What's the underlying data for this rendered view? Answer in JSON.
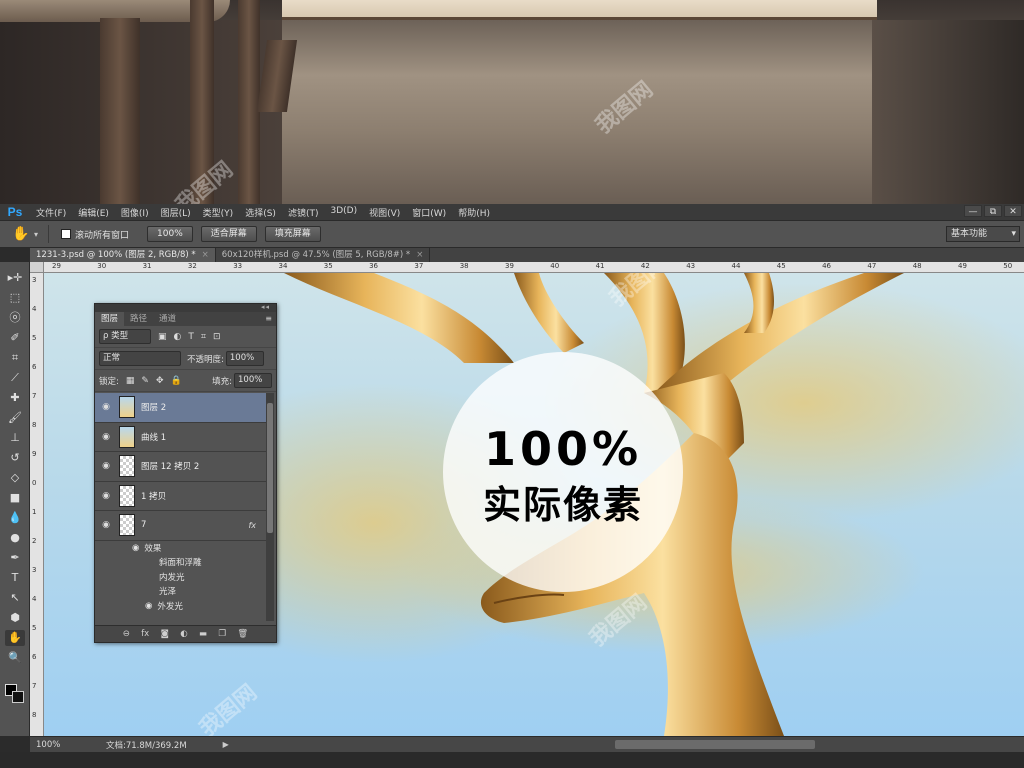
{
  "app": {
    "logo": "Ps"
  },
  "menu": [
    "文件(F)",
    "编辑(E)",
    "图像(I)",
    "图层(L)",
    "类型(Y)",
    "选择(S)",
    "滤镜(T)",
    "3D(D)",
    "视图(V)",
    "窗口(W)",
    "帮助(H)"
  ],
  "window_buttons": [
    "—",
    "⧉",
    "✕"
  ],
  "options_bar": {
    "scroll_all_windows": "滚动所有窗口",
    "scroll_all_windows_checked": false,
    "zoom_button": "100%",
    "fit_screen_button": "适合屏幕",
    "fill_screen_button": "填充屏幕",
    "workspace": "基本功能"
  },
  "documents": [
    {
      "title": "1231-3.psd @ 100% (图层 2, RGB/8) *",
      "active": true
    },
    {
      "title": "60x120样机.psd @ 47.5% (图层 5, RGB/8#) *",
      "active": false
    }
  ],
  "ruler": {
    "h": [
      "29",
      "30",
      "31",
      "32",
      "33",
      "34",
      "35",
      "36",
      "37",
      "38",
      "39",
      "40",
      "41",
      "42",
      "43",
      "44",
      "45",
      "46",
      "47",
      "48",
      "49",
      "50"
    ],
    "v": [
      "3",
      "4",
      "5",
      "6",
      "7",
      "8",
      "9",
      "0",
      "1",
      "2",
      "3",
      "4",
      "5",
      "6",
      "7",
      "8"
    ]
  },
  "overlay": {
    "big_text": "100%",
    "sub_text": "实际像素"
  },
  "watermark": "我图网",
  "status": {
    "zoom": "100%",
    "doc_info": "文档:71.8M/369.2M",
    "arrow": "▶"
  },
  "layers_panel": {
    "tabs": [
      "图层",
      "路径",
      "通道"
    ],
    "filter_kind": "ρ 类型",
    "blend_mode": "正常",
    "opacity_label": "不透明度:",
    "opacity_value": "100%",
    "lock_label": "锁定:",
    "fill_label": "填充:",
    "fill_value": "100%",
    "layers": [
      {
        "name": "图层 2",
        "selected": true,
        "thumb": "photo",
        "fx": ""
      },
      {
        "name": "曲线 1",
        "selected": false,
        "thumb": "photo",
        "fx": ""
      },
      {
        "name": "图层 12 拷贝 2",
        "selected": false,
        "thumb": "transparent",
        "fx": ""
      },
      {
        "name": "1 拷贝",
        "selected": false,
        "thumb": "transparent",
        "fx": ""
      },
      {
        "name": "7",
        "selected": false,
        "thumb": "transparent",
        "fx": "fx"
      }
    ],
    "effects_header": "效果",
    "effects": [
      "斜面和浮雕",
      "内发光",
      "光泽",
      "外发光"
    ],
    "bottom_icons": [
      "link-icon",
      "fx-icon",
      "mask-icon",
      "adjustment-icon",
      "group-icon",
      "new-layer-icon",
      "delete-icon"
    ]
  },
  "tools": [
    "move-icon",
    "marquee-icon",
    "lasso-icon",
    "quick-select-icon",
    "crop-icon",
    "eyedropper-icon",
    "healing-icon",
    "brush-icon",
    "stamp-icon",
    "history-brush-icon",
    "eraser-icon",
    "gradient-icon",
    "blur-icon",
    "dodge-icon",
    "pen-icon",
    "type-icon",
    "path-select-icon",
    "shape-icon",
    "hand-icon",
    "zoom-icon"
  ]
}
